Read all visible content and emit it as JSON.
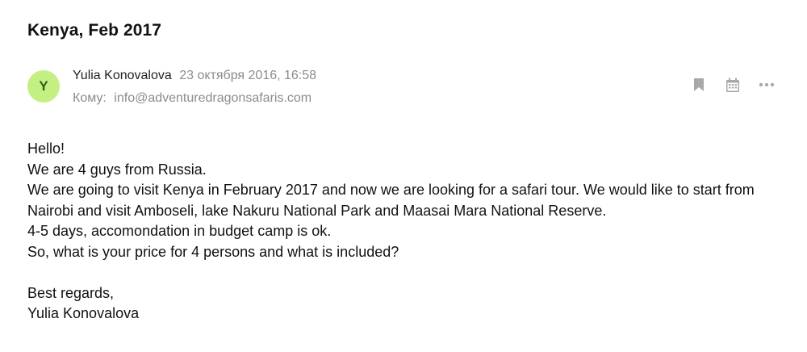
{
  "email": {
    "subject": "Kenya, Feb 2017",
    "sender": {
      "initial": "Y",
      "name": "Yulia Konovalova",
      "date": "23 октября 2016, 16:58",
      "avatar_color": "#c3ef83"
    },
    "recipient": {
      "label": "Кому:",
      "address": "info@adventuredragonsafaris.com"
    },
    "actions": [
      {
        "icon": "bookmark-icon"
      },
      {
        "icon": "calendar-icon"
      },
      {
        "icon": "more-icon"
      }
    ],
    "body": {
      "greeting": "Hello!",
      "line1": "We are 4 guys from Russia.",
      "line2": "We are going to visit Kenya in February 2017 and now we are looking for a safari tour.  We would like to start from Nairobi and visit Amboseli, lake Nakuru National Park and Maasai Mara National Reserve.",
      "line3": "4-5 days, accomondation in budget camp is ok.",
      "line4": "So, what is your price for 4 persons and what is included?",
      "closing": "Best regards,",
      "signature": "Yulia Konovalova"
    }
  }
}
